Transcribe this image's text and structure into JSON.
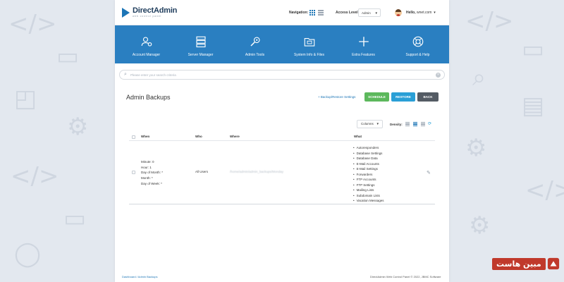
{
  "app": {
    "name": "DirectAdmin",
    "tagline": "web control panel"
  },
  "topbar": {
    "navigation_label": "Navigation:",
    "access_label": "Access Level",
    "access_value": "Admin",
    "hello_prefix": "Hello,",
    "username": "wnet.com"
  },
  "nav": [
    {
      "label": "Account Manager",
      "icon": "account-manager-icon"
    },
    {
      "label": "Server Manager",
      "icon": "server-manager-icon"
    },
    {
      "label": "Admin Tools",
      "icon": "admin-tools-icon"
    },
    {
      "label": "System Info & Files",
      "icon": "folder-icon"
    },
    {
      "label": "Extra Features",
      "icon": "plus-icon"
    },
    {
      "label": "Support & Help",
      "icon": "lifebuoy-icon"
    }
  ],
  "search": {
    "placeholder": "Please enter your search criteria"
  },
  "page": {
    "title": "Admin Backups",
    "settings_link": "+ Backup/Restore Settings",
    "schedule_btn": "SCHEDULE",
    "restore_btn": "RESTORE",
    "back_btn": "BACK"
  },
  "toolbar": {
    "columns_label": "Columns",
    "density_label": "Density:"
  },
  "table": {
    "headers": {
      "when": "When",
      "who": "Who",
      "where": "Where",
      "what": "What"
    },
    "rows": [
      {
        "when": [
          "Minute: 0",
          "Hour: 1",
          "Day of Month: *",
          "Month: *",
          "Day of Week: *"
        ],
        "who": "All Users",
        "where": "/home/admin/admin_backups/Monday",
        "what": [
          "Autoresponders",
          "Database Settings",
          "Database Data",
          "E-Mail Accounts",
          "E-Mail Settings",
          "Forwarders",
          "FTP Accounts",
          "FTP Settings",
          "Mailing Lists",
          "Subdomain Lists",
          "Vacation Messages"
        ]
      }
    ]
  },
  "footer": {
    "breadcrumb": "Dashboard / Admin Backups",
    "copyright": "DirectAdmin Web Control Panel © 2022, JBMC Software"
  },
  "watermark": {
    "text": "مبین هاست"
  },
  "colors": {
    "brand": "#2a7fc1",
    "schedule": "#5cb85c",
    "restore": "#2a9fd6",
    "back": "#545b64"
  }
}
